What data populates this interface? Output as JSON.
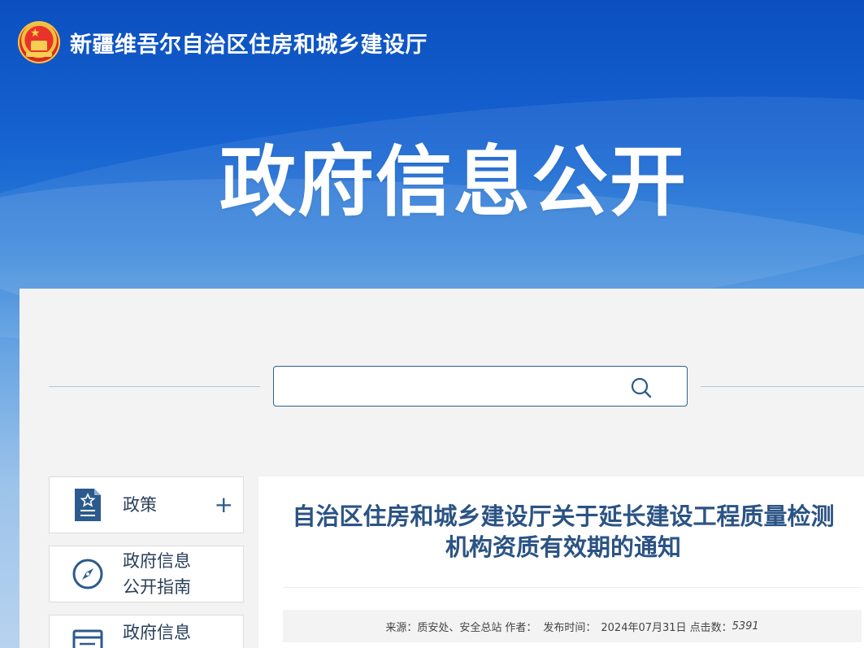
{
  "header": {
    "site_title": "新疆维吾尔自治区住房和城乡建设厅",
    "emblem": "national-emblem-icon"
  },
  "hero": {
    "title": "政府信息公开"
  },
  "search": {
    "placeholder": "",
    "value": "",
    "icon": "search-icon"
  },
  "sidebar": {
    "items": [
      {
        "label": "政策",
        "icon": "document-star-icon",
        "expand": "+"
      },
      {
        "label": "政府信息\n公开指南",
        "icon": "compass-icon"
      },
      {
        "label": "政府信息",
        "icon": "list-icon"
      }
    ]
  },
  "article": {
    "title": "自治区住房和城乡建设厅关于延长建设工程质量检测机构资质有效期的通知",
    "meta": {
      "source_label": "来源：",
      "source": "质安处、安全总站",
      "author_label": "作者：",
      "author": "",
      "date_label": "发布时间：",
      "date": "2024年07月31日",
      "views_label": "点击数：",
      "views": "5391"
    }
  },
  "colors": {
    "banner_top": "#0b4fbf",
    "title_blue": "#2b5384",
    "icon_blue": "#2c5a8c"
  }
}
